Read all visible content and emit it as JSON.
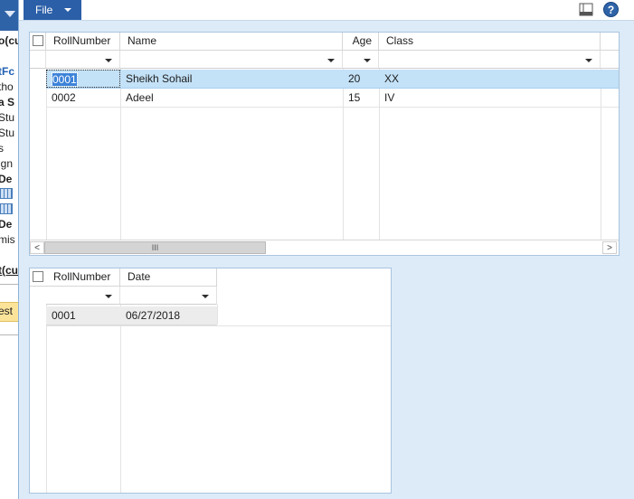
{
  "background_window": {
    "fragments": [
      "o(cu",
      "tFc",
      "tho",
      "a S",
      "Stu",
      "Stu",
      "s",
      "ign",
      "De",
      "De",
      "mis",
      "t(cu",
      "est"
    ]
  },
  "ribbon": {
    "file_label": "File",
    "icons": [
      "layout-icon",
      "help-icon"
    ],
    "help_glyph": "?"
  },
  "grid_students": {
    "columns": [
      "RollNumber",
      "Name",
      "Age",
      "Class"
    ],
    "rows": [
      {
        "roll": "0001",
        "name": "Sheikh Sohail",
        "age": "20",
        "class": "XX",
        "selected": true
      },
      {
        "roll": "0002",
        "name": "Adeel",
        "age": "15",
        "class": "IV",
        "selected": false
      }
    ],
    "scroll_thumb_glyph": "III",
    "scroll_left_glyph": "<",
    "scroll_right_glyph": ">"
  },
  "grid_dates": {
    "columns": [
      "RollNumber",
      "Date"
    ],
    "rows": [
      {
        "roll": "0001",
        "date": "06/27/2018"
      }
    ]
  },
  "colors": {
    "accent": "#2b5fa8",
    "form_background": "#dcebf7",
    "selection": "#c3e1f7"
  }
}
